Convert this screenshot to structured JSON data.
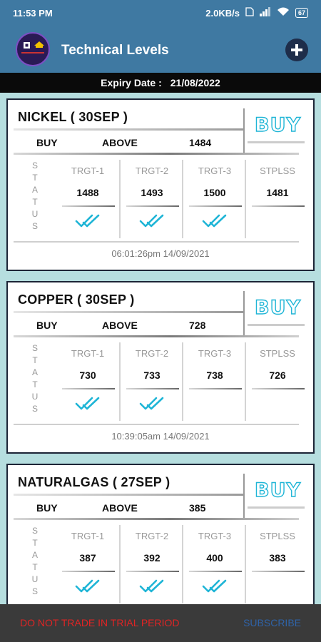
{
  "status_bar": {
    "time": "11:53 PM",
    "speed": "2.0KB/s",
    "battery": "67"
  },
  "app": {
    "title": "Technical Levels"
  },
  "expiry": {
    "label": "Expiry Date :",
    "date": "21/08/2022"
  },
  "status_label_letters": [
    "S",
    "T",
    "A",
    "T",
    "U",
    "S"
  ],
  "cards": [
    {
      "symbol": "NICKEL ( 30SEP )",
      "signal": "BUY",
      "side": "BUY",
      "condition": "ABOVE",
      "level": "1484",
      "targets": [
        {
          "label": "TRGT-1",
          "value": "1488",
          "hit": true
        },
        {
          "label": "TRGT-2",
          "value": "1493",
          "hit": true
        },
        {
          "label": "TRGT-3",
          "value": "1500",
          "hit": true
        },
        {
          "label": "STPLSS",
          "value": "1481",
          "hit": false
        }
      ],
      "timestamp": "06:01:26pm 14/09/2021"
    },
    {
      "symbol": "COPPER ( 30SEP )",
      "signal": "BUY",
      "side": "BUY",
      "condition": "ABOVE",
      "level": "728",
      "targets": [
        {
          "label": "TRGT-1",
          "value": "730",
          "hit": true
        },
        {
          "label": "TRGT-2",
          "value": "733",
          "hit": true
        },
        {
          "label": "TRGT-3",
          "value": "738",
          "hit": false
        },
        {
          "label": "STPLSS",
          "value": "726",
          "hit": false
        }
      ],
      "timestamp": "10:39:05am 14/09/2021"
    },
    {
      "symbol": "NATURALGAS ( 27SEP )",
      "signal": "BUY",
      "side": "BUY",
      "condition": "ABOVE",
      "level": "385",
      "targets": [
        {
          "label": "TRGT-1",
          "value": "387",
          "hit": true
        },
        {
          "label": "TRGT-2",
          "value": "392",
          "hit": true
        },
        {
          "label": "TRGT-3",
          "value": "400",
          "hit": true
        },
        {
          "label": "STPLSS",
          "value": "383",
          "hit": false
        }
      ],
      "timestamp": ""
    }
  ],
  "bottom": {
    "warning": "DO NOT TRADE IN TRIAL PERIOD",
    "subscribe": "SUBSCRIBE"
  },
  "colors": {
    "header": "#3f79a2",
    "background": "#b6dedf",
    "signal": "#1fb5d6",
    "check": "#1fb5d6",
    "warning": "#e02424",
    "subscribe": "#2f63a8"
  }
}
